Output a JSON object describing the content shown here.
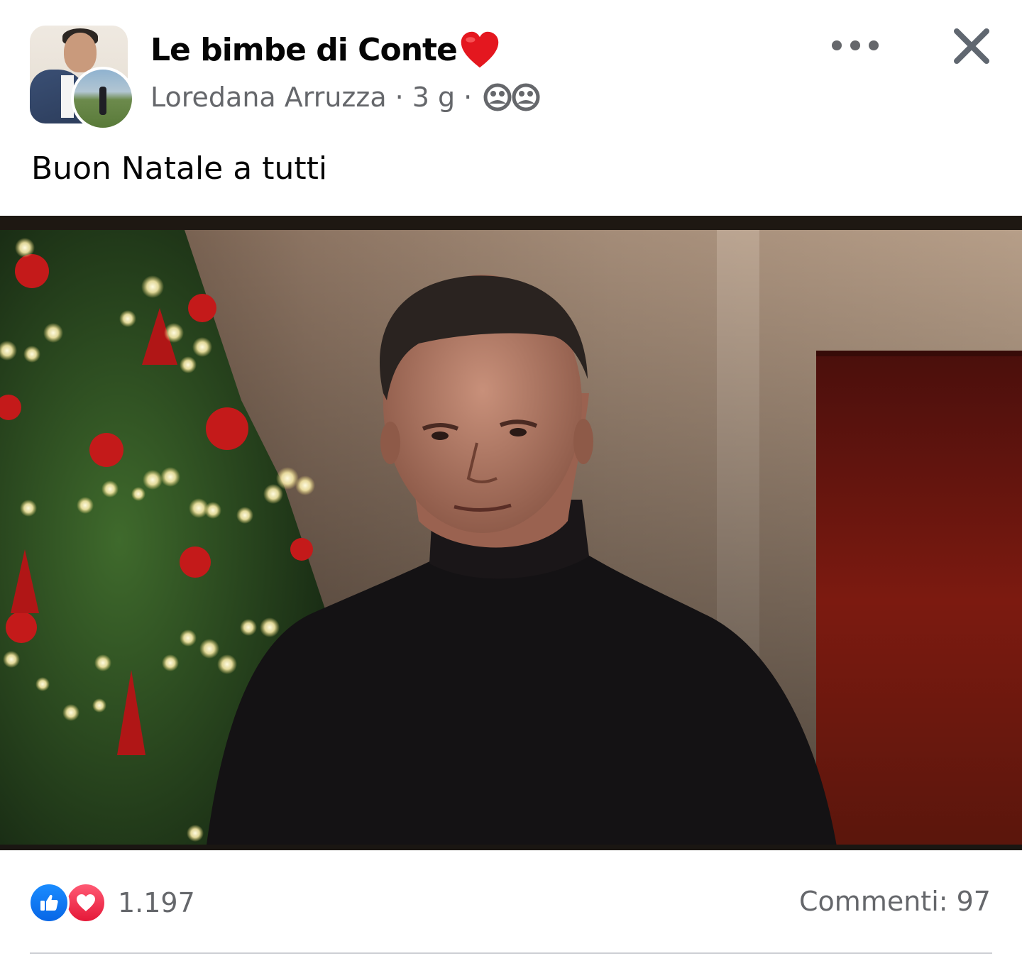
{
  "header": {
    "group_name": "Le bimbe di Conte",
    "author": "Loredana Arruzza",
    "separator": "·",
    "timestamp": "3 g",
    "audience_icon": "groups-icon",
    "group_avatar_icon": "group-avatar",
    "user_avatar_icon": "user-avatar",
    "title_emoji_icon": "red-heart-icon",
    "more_icon": "more-horizontal-icon",
    "close_icon": "close-icon"
  },
  "post": {
    "text": "Buon Natale a tutti",
    "media_type": "video"
  },
  "footer": {
    "reactions": [
      "like-icon",
      "love-icon"
    ],
    "reaction_count": "1.197",
    "comments_label": "Commenti: 97"
  },
  "colors": {
    "text_primary": "#050505",
    "text_secondary": "#65676b",
    "like_blue": "#0866e6",
    "love_red": "#e51838",
    "divider": "#ced0d4"
  }
}
